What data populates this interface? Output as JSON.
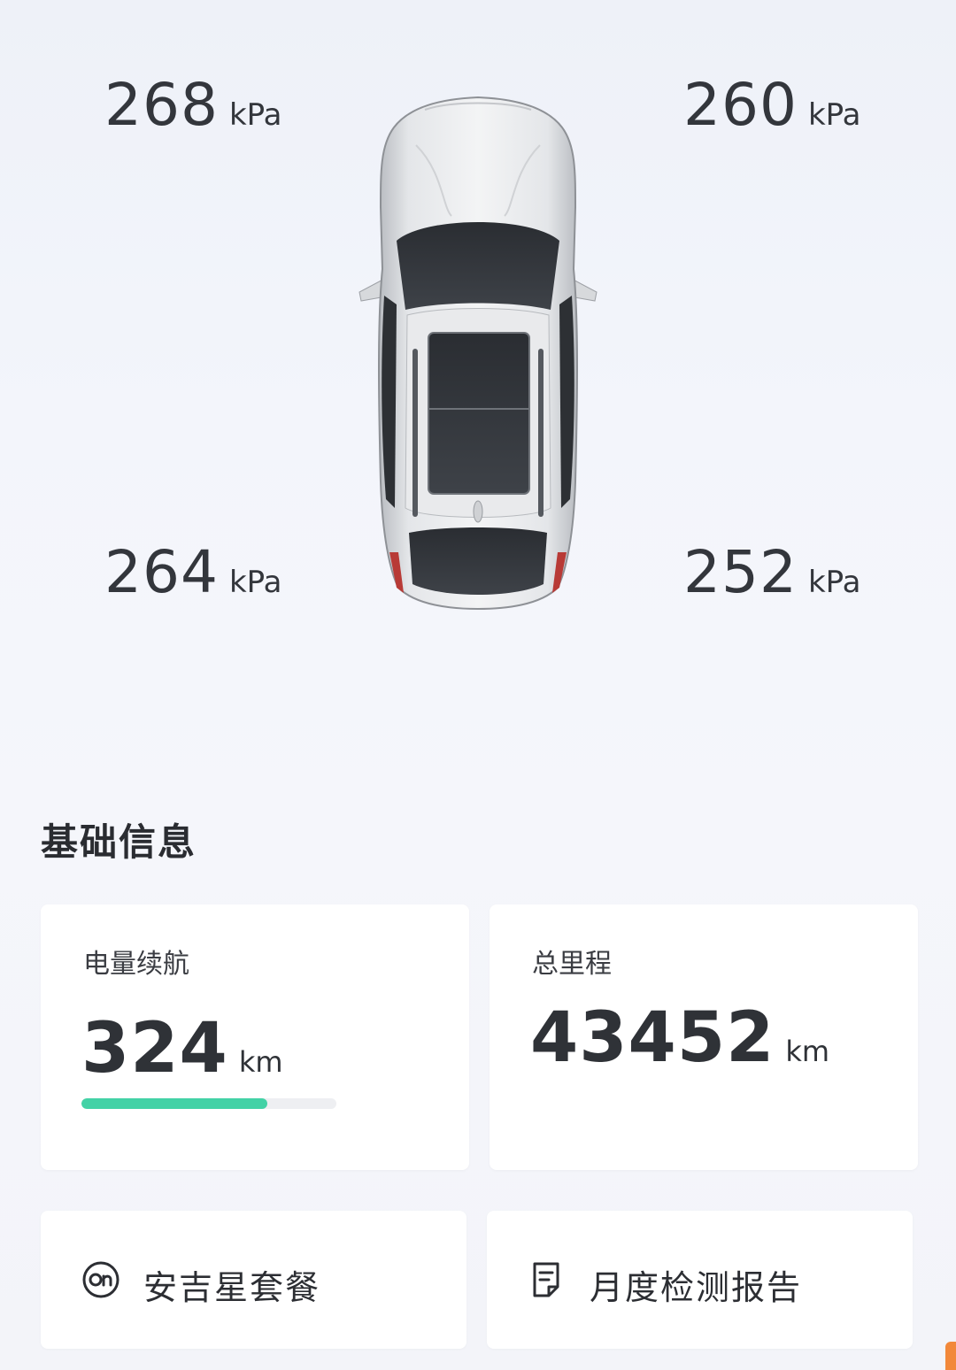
{
  "tires": {
    "front_left": {
      "value": "268",
      "unit": "kPa"
    },
    "front_right": {
      "value": "260",
      "unit": "kPa"
    },
    "rear_left": {
      "value": "264",
      "unit": "kPa"
    },
    "rear_right": {
      "value": "252",
      "unit": "kPa"
    }
  },
  "section_title": "基础信息",
  "range_card": {
    "label": "电量续航",
    "value": "324",
    "unit": "km",
    "battery_fraction": 0.73,
    "bar_color": "#43d2a6"
  },
  "odometer_card": {
    "label": "总里程",
    "value": "43452",
    "unit": "km"
  },
  "actions": {
    "plan": {
      "label": "安吉星套餐",
      "icon": "onstar-icon"
    },
    "report": {
      "label": "月度检测报告",
      "icon": "document-icon"
    }
  },
  "accent_color": "#f2883a"
}
